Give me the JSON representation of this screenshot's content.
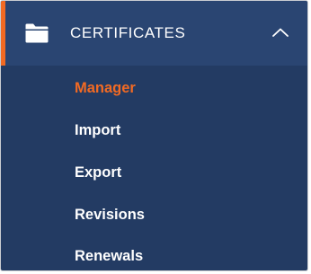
{
  "section": {
    "title": "CERTIFICATES",
    "icon": "folder-icon",
    "expanded_icon": "chevron-up-icon",
    "accent_color": "#f26a23"
  },
  "menu": {
    "items": [
      {
        "label": "Manager",
        "active": true
      },
      {
        "label": "Import",
        "active": false
      },
      {
        "label": "Export",
        "active": false
      },
      {
        "label": "Revisions",
        "active": false
      },
      {
        "label": "Renewals",
        "active": false
      }
    ]
  }
}
